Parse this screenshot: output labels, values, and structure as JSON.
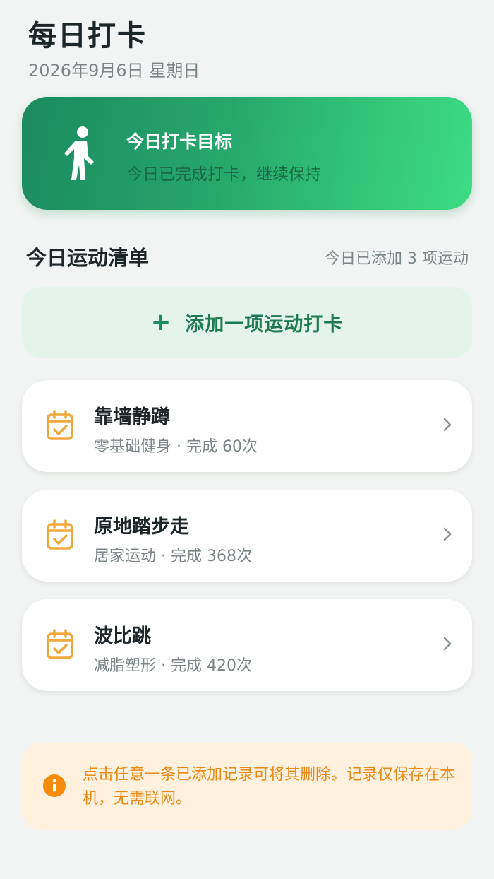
{
  "header": {
    "title": "每日打卡",
    "date": "2026年9月6日 星期日"
  },
  "goal_card": {
    "icon": "walking-person-icon",
    "title": "今日打卡目标",
    "subtitle": "今日已完成打卡，继续保持"
  },
  "section": {
    "title": "今日运动清单",
    "count_text": "今日已添加 3 项运动"
  },
  "add_button": {
    "icon": "plus-icon",
    "label": "添加一项运动打卡"
  },
  "items": [
    {
      "name": "靠墙静蹲",
      "meta": "零基础健身 · 完成 60次",
      "icon": "calendar-check-icon"
    },
    {
      "name": "原地踏步走",
      "meta": "居家运动 · 完成 368次",
      "icon": "calendar-check-icon"
    },
    {
      "name": "波比跳",
      "meta": "减脂塑形 · 完成 420次",
      "icon": "calendar-check-icon"
    }
  ],
  "info": {
    "icon": "info-icon",
    "text": "点击任意一条已添加记录可将其删除。记录仅保存在本机，无需联网。"
  },
  "colors": {
    "accent_green": "#1e8c5b",
    "calendar_orange": "#f2a93b",
    "info_orange": "#e88a15"
  }
}
